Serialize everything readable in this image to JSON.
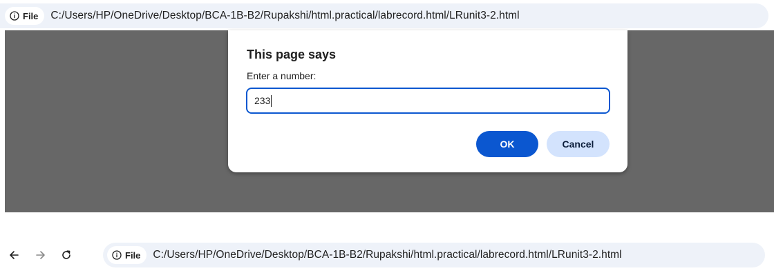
{
  "address_bar": {
    "security_chip_label": "File",
    "url": "C:/Users/HP/OneDrive/Desktop/BCA-1B-B2/Rupakshi/html.practical/labrecord.html/LRunit3-2.html"
  },
  "dialog": {
    "title": "This page says",
    "message": "Enter a number:",
    "input_value": "233",
    "ok_label": "OK",
    "cancel_label": "Cancel"
  },
  "toolbar": {
    "back_icon": "arrow-left-icon",
    "forward_icon": "arrow-right-icon",
    "reload_icon": "reload-icon",
    "security_chip_label": "File",
    "url": "C:/Users/HP/OneDrive/Desktop/BCA-1B-B2/Rupakshi/html.practical/labrecord.html/LRunit3-2.html"
  },
  "colors": {
    "accent": "#0b57d0",
    "cancel_bg": "#d3e3fd",
    "page_overlay": "#676767",
    "omnibox_bg": "#eef2f9"
  }
}
